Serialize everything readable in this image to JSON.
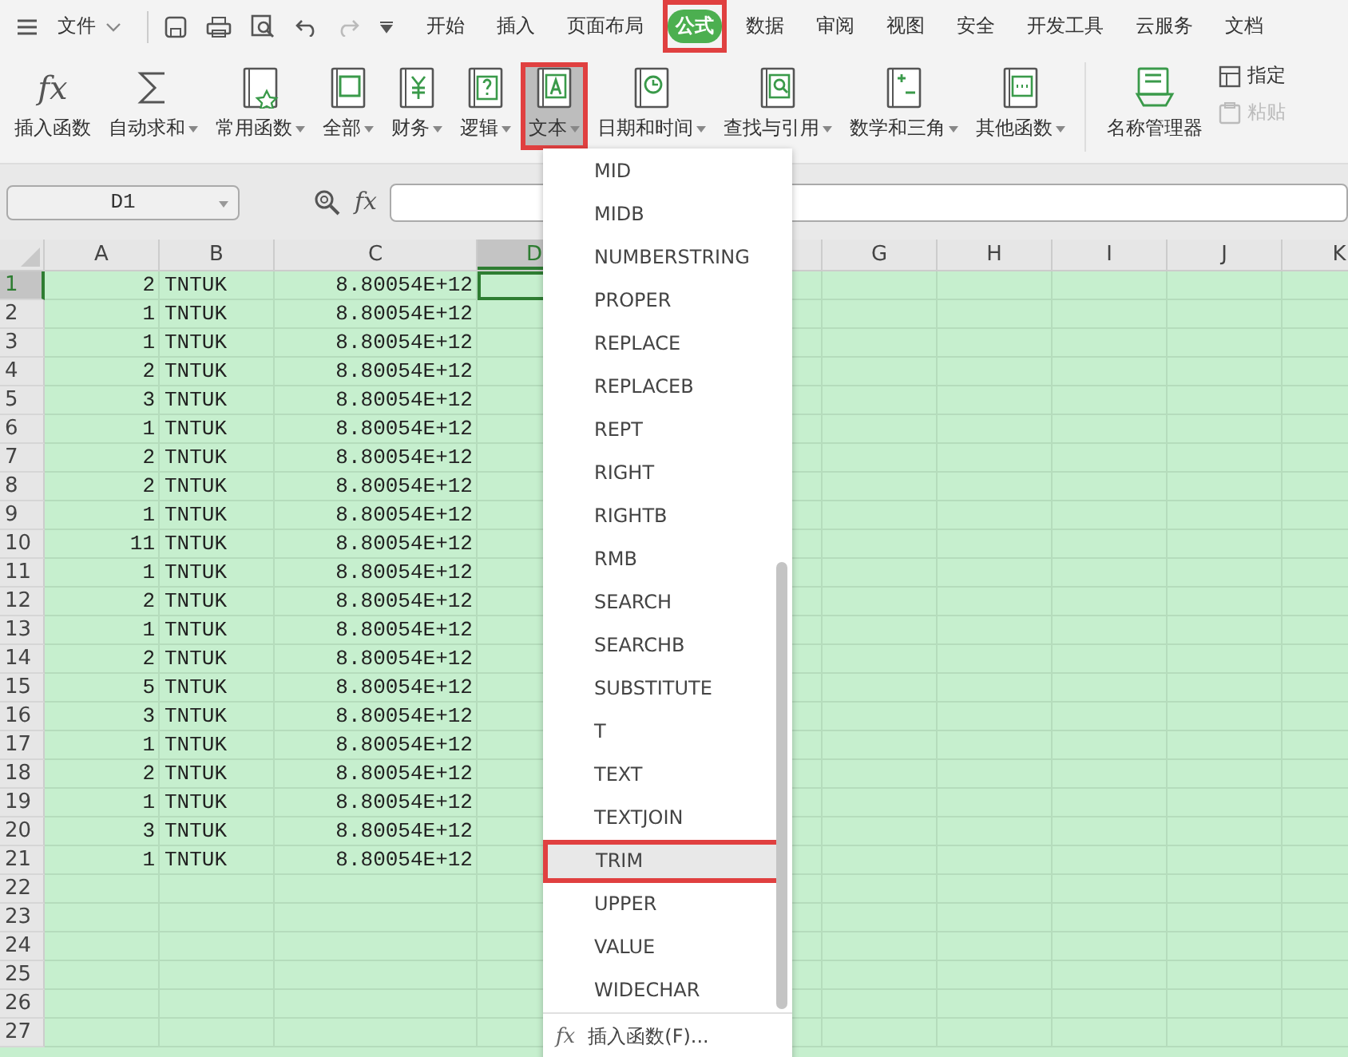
{
  "menu_bar": {
    "file_label": "文件",
    "tabs": [
      {
        "label": "开始",
        "selected": false,
        "annotated": false
      },
      {
        "label": "插入",
        "selected": false,
        "annotated": false
      },
      {
        "label": "页面布局",
        "selected": false,
        "annotated": false
      },
      {
        "label": "公式",
        "selected": true,
        "annotated": true
      },
      {
        "label": "数据",
        "selected": false,
        "annotated": false
      },
      {
        "label": "审阅",
        "selected": false,
        "annotated": false
      },
      {
        "label": "视图",
        "selected": false,
        "annotated": false
      },
      {
        "label": "安全",
        "selected": false,
        "annotated": false
      },
      {
        "label": "开发工具",
        "selected": false,
        "annotated": false
      },
      {
        "label": "云服务",
        "selected": false,
        "annotated": false
      },
      {
        "label": "文档",
        "selected": false,
        "annotated": false
      }
    ]
  },
  "ribbon": {
    "buttons": [
      {
        "label": "插入函数",
        "kind": "fx",
        "mark": "fx",
        "dropdown": false,
        "pressed": false,
        "annotated": false
      },
      {
        "label": "自动求和",
        "kind": "sigma",
        "dropdown": true,
        "pressed": false,
        "annotated": false
      },
      {
        "label": "常用函数",
        "kind": "star",
        "dropdown": true,
        "pressed": false,
        "annotated": false
      },
      {
        "label": "全部",
        "kind": "fxbook",
        "dropdown": true,
        "pressed": false,
        "annotated": false
      },
      {
        "label": "财务",
        "kind": "yen",
        "dropdown": true,
        "pressed": false,
        "annotated": false
      },
      {
        "label": "逻辑",
        "kind": "question",
        "dropdown": true,
        "pressed": false,
        "annotated": false
      },
      {
        "label": "文本",
        "kind": "letter",
        "dropdown": true,
        "pressed": true,
        "annotated": true
      },
      {
        "label": "日期和时间",
        "kind": "clock",
        "dropdown": true,
        "pressed": false,
        "annotated": false
      },
      {
        "label": "查找与引用",
        "kind": "search",
        "dropdown": true,
        "pressed": false,
        "annotated": false
      },
      {
        "label": "数学和三角",
        "kind": "math",
        "dropdown": true,
        "pressed": false,
        "annotated": false
      },
      {
        "label": "其他函数",
        "kind": "dots",
        "dropdown": true,
        "pressed": false,
        "annotated": false
      },
      {
        "label": "名称管理器",
        "kind": "names",
        "dropdown": false,
        "pressed": false,
        "annotated": false
      }
    ],
    "small_buttons": [
      {
        "label": "指定",
        "disabled": false
      },
      {
        "label": "粘贴",
        "disabled": true
      }
    ]
  },
  "formula_bar": {
    "name_box": "D1",
    "function_mark": "fx"
  },
  "sheet": {
    "columns": [
      {
        "label": "A",
        "selected": false
      },
      {
        "label": "B",
        "selected": false
      },
      {
        "label": "C",
        "selected": false
      },
      {
        "label": "D",
        "selected": true
      },
      null,
      null,
      {
        "label": "G",
        "selected": false
      },
      {
        "label": "H",
        "selected": false
      },
      {
        "label": "I",
        "selected": false
      },
      {
        "label": "J",
        "selected": false
      },
      {
        "label": "K",
        "selected": false
      }
    ],
    "rows": [
      {
        "number": "1",
        "selected": true,
        "cells": [
          "2",
          "TNTUK",
          "8.80054E+12"
        ]
      },
      {
        "number": "2",
        "selected": false,
        "cells": [
          "1",
          "TNTUK",
          "8.80054E+12"
        ]
      },
      {
        "number": "3",
        "selected": false,
        "cells": [
          "1",
          "TNTUK",
          "8.80054E+12"
        ]
      },
      {
        "number": "4",
        "selected": false,
        "cells": [
          "2",
          "TNTUK",
          "8.80054E+12"
        ]
      },
      {
        "number": "5",
        "selected": false,
        "cells": [
          "3",
          "TNTUK",
          "8.80054E+12"
        ]
      },
      {
        "number": "6",
        "selected": false,
        "cells": [
          "1",
          "TNTUK",
          "8.80054E+12"
        ]
      },
      {
        "number": "7",
        "selected": false,
        "cells": [
          "2",
          "TNTUK",
          "8.80054E+12"
        ]
      },
      {
        "number": "8",
        "selected": false,
        "cells": [
          "2",
          "TNTUK",
          "8.80054E+12"
        ]
      },
      {
        "number": "9",
        "selected": false,
        "cells": [
          "1",
          "TNTUK",
          "8.80054E+12"
        ]
      },
      {
        "number": "10",
        "selected": false,
        "cells": [
          "11",
          "TNTUK",
          "8.80054E+12"
        ]
      },
      {
        "number": "11",
        "selected": false,
        "cells": [
          "1",
          "TNTUK",
          "8.80054E+12"
        ]
      },
      {
        "number": "12",
        "selected": false,
        "cells": [
          "2",
          "TNTUK",
          "8.80054E+12"
        ]
      },
      {
        "number": "13",
        "selected": false,
        "cells": [
          "1",
          "TNTUK",
          "8.80054E+12"
        ]
      },
      {
        "number": "14",
        "selected": false,
        "cells": [
          "2",
          "TNTUK",
          "8.80054E+12"
        ]
      },
      {
        "number": "15",
        "selected": false,
        "cells": [
          "5",
          "TNTUK",
          "8.80054E+12"
        ]
      },
      {
        "number": "16",
        "selected": false,
        "cells": [
          "3",
          "TNTUK",
          "8.80054E+12"
        ]
      },
      {
        "number": "17",
        "selected": false,
        "cells": [
          "1",
          "TNTUK",
          "8.80054E+12"
        ]
      },
      {
        "number": "18",
        "selected": false,
        "cells": [
          "2",
          "TNTUK",
          "8.80054E+12"
        ]
      },
      {
        "number": "19",
        "selected": false,
        "cells": [
          "1",
          "TNTUK",
          "8.80054E+12"
        ]
      },
      {
        "number": "20",
        "selected": false,
        "cells": [
          "3",
          "TNTUK",
          "8.80054E+12"
        ]
      },
      {
        "number": "21",
        "selected": false,
        "cells": [
          "1",
          "TNTUK",
          "8.80054E+12"
        ]
      },
      {
        "number": "22",
        "selected": false,
        "cells": []
      },
      {
        "number": "23",
        "selected": false,
        "cells": []
      },
      {
        "number": "24",
        "selected": false,
        "cells": []
      },
      {
        "number": "25",
        "selected": false,
        "cells": []
      },
      {
        "number": "26",
        "selected": false,
        "cells": []
      },
      {
        "number": "27",
        "selected": false,
        "cells": []
      }
    ]
  },
  "dropdown": {
    "items": [
      {
        "label": "MID",
        "hovered": false,
        "annotated": false
      },
      {
        "label": "MIDB",
        "hovered": false,
        "annotated": false
      },
      {
        "label": "NUMBERSTRING",
        "hovered": false,
        "annotated": false
      },
      {
        "label": "PROPER",
        "hovered": false,
        "annotated": false
      },
      {
        "label": "REPLACE",
        "hovered": false,
        "annotated": false
      },
      {
        "label": "REPLACEB",
        "hovered": false,
        "annotated": false
      },
      {
        "label": "REPT",
        "hovered": false,
        "annotated": false
      },
      {
        "label": "RIGHT",
        "hovered": false,
        "annotated": false
      },
      {
        "label": "RIGHTB",
        "hovered": false,
        "annotated": false
      },
      {
        "label": "RMB",
        "hovered": false,
        "annotated": false
      },
      {
        "label": "SEARCH",
        "hovered": false,
        "annotated": false
      },
      {
        "label": "SEARCHB",
        "hovered": false,
        "annotated": false
      },
      {
        "label": "SUBSTITUTE",
        "hovered": false,
        "annotated": false
      },
      {
        "label": "T",
        "hovered": false,
        "annotated": false
      },
      {
        "label": "TEXT",
        "hovered": false,
        "annotated": false
      },
      {
        "label": "TEXTJOIN",
        "hovered": false,
        "annotated": false
      },
      {
        "label": "TRIM",
        "hovered": true,
        "annotated": true
      },
      {
        "label": "UPPER",
        "hovered": false,
        "annotated": false
      },
      {
        "label": "VALUE",
        "hovered": false,
        "annotated": false
      },
      {
        "label": "WIDECHAR",
        "hovered": false,
        "annotated": false
      }
    ],
    "footer_mark": "fx",
    "footer": "插入函数(F)..."
  }
}
